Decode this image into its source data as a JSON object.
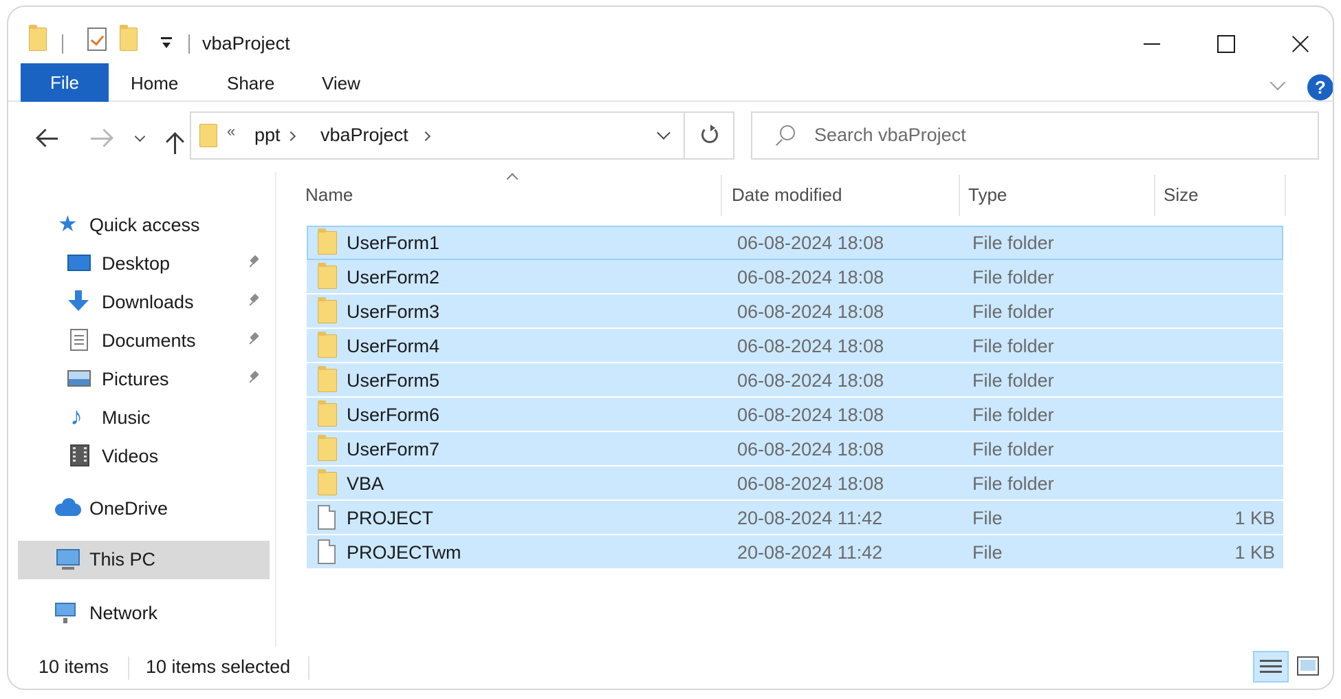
{
  "window": {
    "title": "vbaProject"
  },
  "ribbon": {
    "tabs": [
      "File",
      "Home",
      "Share",
      "View"
    ],
    "help_label": "?"
  },
  "address": {
    "overflow": "«",
    "crumbs": [
      "ppt",
      "vbaProject"
    ]
  },
  "search": {
    "placeholder": "Search vbaProject"
  },
  "navpane": {
    "quick_access": "Quick access",
    "items": [
      {
        "label": "Desktop",
        "icon": "desktop-icon",
        "pinned": true
      },
      {
        "label": "Downloads",
        "icon": "downloads-icon",
        "pinned": true
      },
      {
        "label": "Documents",
        "icon": "documents-icon",
        "pinned": true
      },
      {
        "label": "Pictures",
        "icon": "pictures-icon",
        "pinned": true
      },
      {
        "label": "Music",
        "icon": "music-icon",
        "pinned": false
      },
      {
        "label": "Videos",
        "icon": "videos-icon",
        "pinned": false
      }
    ],
    "onedrive": "OneDrive",
    "this_pc": "This PC",
    "network": "Network"
  },
  "filelist": {
    "columns": [
      "Name",
      "Date modified",
      "Type",
      "Size"
    ],
    "sort_column": "Name",
    "rows": [
      {
        "name": "UserForm1",
        "date": "06-08-2024 18:08",
        "type": "File folder",
        "size": "",
        "icon": "folder-icon"
      },
      {
        "name": "UserForm2",
        "date": "06-08-2024 18:08",
        "type": "File folder",
        "size": "",
        "icon": "folder-icon"
      },
      {
        "name": "UserForm3",
        "date": "06-08-2024 18:08",
        "type": "File folder",
        "size": "",
        "icon": "folder-icon"
      },
      {
        "name": "UserForm4",
        "date": "06-08-2024 18:08",
        "type": "File folder",
        "size": "",
        "icon": "folder-icon"
      },
      {
        "name": "UserForm5",
        "date": "06-08-2024 18:08",
        "type": "File folder",
        "size": "",
        "icon": "folder-icon"
      },
      {
        "name": "UserForm6",
        "date": "06-08-2024 18:08",
        "type": "File folder",
        "size": "",
        "icon": "folder-icon"
      },
      {
        "name": "UserForm7",
        "date": "06-08-2024 18:08",
        "type": "File folder",
        "size": "",
        "icon": "folder-icon"
      },
      {
        "name": "VBA",
        "date": "06-08-2024 18:08",
        "type": "File folder",
        "size": "",
        "icon": "folder-icon"
      },
      {
        "name": "PROJECT",
        "date": "20-08-2024 11:42",
        "type": "File",
        "size": "1 KB",
        "icon": "file-icon"
      },
      {
        "name": "PROJECTwm",
        "date": "20-08-2024 11:42",
        "type": "File",
        "size": "1 KB",
        "icon": "file-icon"
      }
    ]
  },
  "status": {
    "item_count": "10 items",
    "selected_count": "10 items selected"
  },
  "colors": {
    "accent": "#1a63c3",
    "selection": "#cce8ff",
    "selection_border": "#99d1ff",
    "folder": "#f8d775"
  }
}
